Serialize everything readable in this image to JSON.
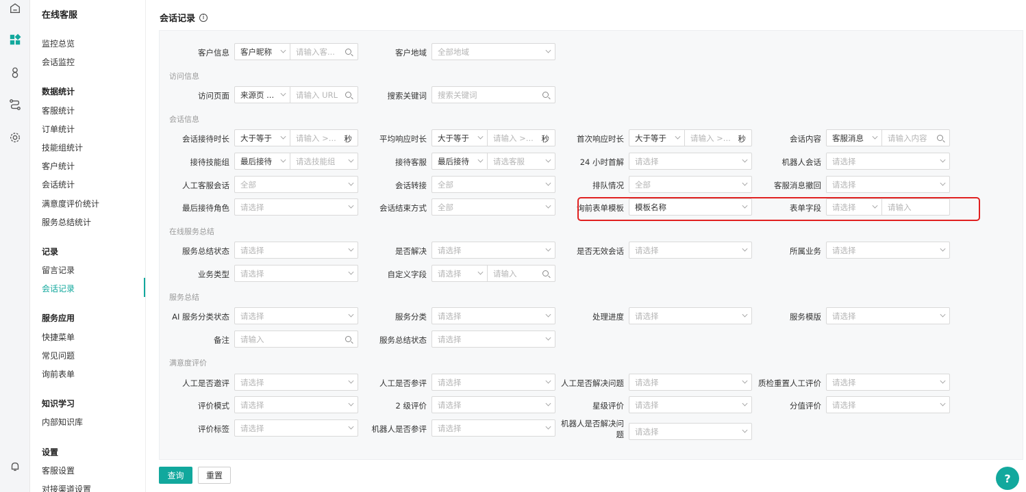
{
  "rail": {
    "icons": [
      "home-icon",
      "apps-icon",
      "user-icon",
      "flow-icon",
      "gear-icon",
      "bell-icon"
    ]
  },
  "sidebar": {
    "app_title": "在线客服",
    "groups": [
      {
        "title": "",
        "items": [
          "监控总览",
          "会话监控"
        ]
      },
      {
        "title": "数据统计",
        "items": [
          "客服统计",
          "订单统计",
          "技能组统计",
          "客户统计",
          "会话统计",
          "满意度评价统计",
          "服务总结统计"
        ]
      },
      {
        "title": "记录",
        "items": [
          "留言记录",
          "会话记录"
        ]
      },
      {
        "title": "服务应用",
        "items": [
          "快捷菜单",
          "常见问题",
          "询前表单"
        ]
      },
      {
        "title": "知识学习",
        "items": [
          "内部知识库"
        ]
      },
      {
        "title": "设置",
        "items": [
          "客服设置",
          "对接渠道设置"
        ]
      }
    ],
    "active_item": "会话记录"
  },
  "page": {
    "title": "会话记录",
    "info_icon": "i"
  },
  "sections": {
    "visit": "访问信息",
    "session": "会话信息",
    "online_summary": "在线服务总结",
    "service_summary": "服务总结",
    "satisfaction": "满意度评价"
  },
  "fields": {
    "customer_info": {
      "label": "客户信息",
      "select": "客户昵称",
      "placeholder": "请输入客..."
    },
    "customer_region": {
      "label": "客户地域",
      "placeholder": "全部地域"
    },
    "visit_page": {
      "label": "访问页面",
      "select": "来源页 ...",
      "placeholder": "请输入 URL"
    },
    "search_keyword": {
      "label": "搜索关键词",
      "placeholder": "搜索关键词"
    },
    "reception_duration": {
      "label": "会话接待时长",
      "select": "大于等于",
      "placeholder": "请输入 >...",
      "suffix": "秒"
    },
    "avg_response": {
      "label": "平均响应时长",
      "select": "大于等于",
      "placeholder": "请输入 >...",
      "suffix": "秒"
    },
    "first_response": {
      "label": "首次响应时长",
      "select": "大于等于",
      "placeholder": "请输入 >...",
      "suffix": "秒"
    },
    "session_content": {
      "label": "会话内容",
      "select": "客服消息",
      "placeholder": "请输入内容"
    },
    "reception_skill": {
      "label": "接待技能组",
      "select": "最后接待",
      "placeholder": "请选技能组"
    },
    "reception_agent": {
      "label": "接待客服",
      "select": "最后接待",
      "placeholder": "请选客服"
    },
    "first_solve_24h": {
      "label": "24 小时首解",
      "placeholder": "请选择"
    },
    "robot_session": {
      "label": "机器人会话",
      "placeholder": "请选择"
    },
    "human_session": {
      "label": "人工客服会话",
      "value": "全部"
    },
    "session_transfer": {
      "label": "会话转接",
      "value": "全部"
    },
    "queue_status": {
      "label": "排队情况",
      "value": "全部"
    },
    "msg_recall": {
      "label": "客服消息撤回",
      "placeholder": "请选择"
    },
    "last_role": {
      "label": "最后接待角色",
      "placeholder": "请选择"
    },
    "end_method": {
      "label": "会话结束方式",
      "value": "全部"
    },
    "preform_template": {
      "label": "询前表单模板",
      "value": "模板名称"
    },
    "form_field": {
      "label": "表单字段",
      "select_placeholder": "请选择",
      "placeholder": "请输入"
    },
    "summary_status": {
      "label": "服务总结状态",
      "placeholder": "请选择"
    },
    "is_solved": {
      "label": "是否解决",
      "placeholder": "请选择"
    },
    "is_invalid": {
      "label": "是否无效会话",
      "placeholder": "请选择"
    },
    "business": {
      "label": "所属业务",
      "placeholder": "请选择"
    },
    "business_type": {
      "label": "业务类型",
      "placeholder": "请选择"
    },
    "custom_field": {
      "label": "自定义字段",
      "select_placeholder": "请选择",
      "placeholder": "请输入"
    },
    "ai_classify": {
      "label": "AI 服务分类状态",
      "placeholder": "请选择"
    },
    "service_class": {
      "label": "服务分类",
      "placeholder": "请选择"
    },
    "progress": {
      "label": "处理进度",
      "placeholder": "请选择"
    },
    "service_template": {
      "label": "服务模版",
      "placeholder": "请选择"
    },
    "remark": {
      "label": "备注",
      "placeholder": "请输入"
    },
    "summary_status2": {
      "label": "服务总结状态",
      "placeholder": "请选择"
    },
    "human_invited": {
      "label": "人工是否邀评",
      "placeholder": "请选择"
    },
    "human_rated": {
      "label": "人工是否参评",
      "placeholder": "请选择"
    },
    "human_solved": {
      "label": "人工是否解决问题",
      "placeholder": "请选择"
    },
    "qc_reset": {
      "label": "质检重置人工评价",
      "placeholder": "请选择"
    },
    "rating_mode": {
      "label": "评价模式",
      "placeholder": "请选择"
    },
    "level2_rating": {
      "label": "2 级评价",
      "placeholder": "请选择"
    },
    "star_rating": {
      "label": "星级评价",
      "placeholder": "请选择"
    },
    "score_rating": {
      "label": "分值评价",
      "placeholder": "请选择"
    },
    "rating_tag": {
      "label": "评价标签",
      "placeholder": "请选择"
    },
    "robot_rated": {
      "label": "机器人是否参评",
      "placeholder": "请选择"
    },
    "robot_solved": {
      "label": "机器人是否解决问题",
      "placeholder": "请选择"
    }
  },
  "buttons": {
    "query": "查询",
    "reset": "重置"
  },
  "help": "?",
  "colors": {
    "accent": "#12a89d",
    "highlight": "#e02020"
  }
}
